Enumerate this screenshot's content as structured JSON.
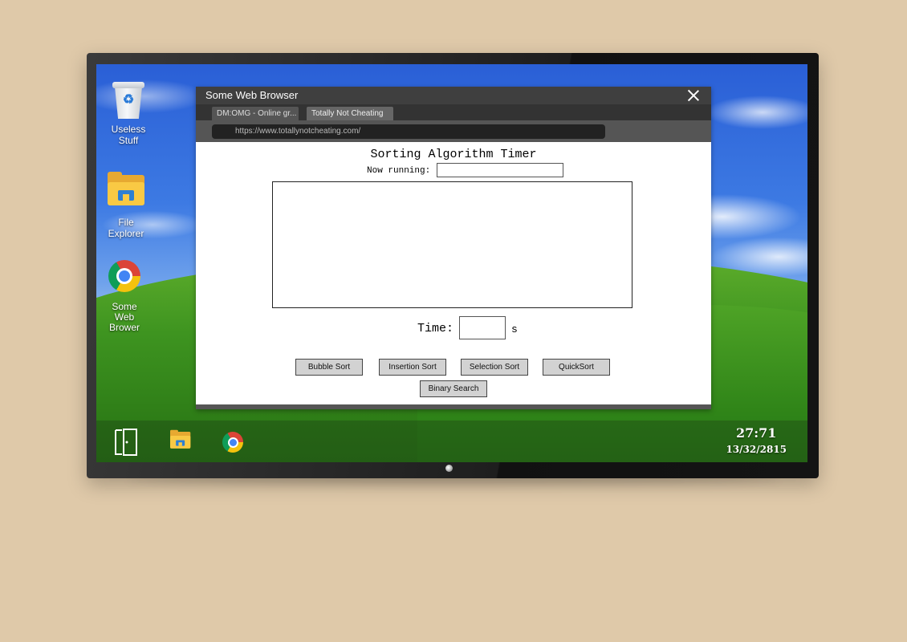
{
  "desktop": {
    "icons": [
      {
        "label": "Useless\nStuff",
        "icon": "recycle-bin-icon"
      },
      {
        "label": "File\nExplorer",
        "icon": "folder-icon"
      },
      {
        "label": "Some\nWeb\nBrower",
        "icon": "chrome-icon"
      }
    ]
  },
  "taskbar": {
    "items": [
      "exit-door-icon",
      "folder-icon",
      "chrome-icon"
    ],
    "clock": {
      "time": "27:71",
      "date": "13/32/2815"
    }
  },
  "browser": {
    "title": "Some Web Browser",
    "tabs": [
      {
        "label": "DM:OMG - Online gr..."
      },
      {
        "label": "Totally Not Cheating"
      }
    ],
    "url": "https://www.totallynotcheating.com/"
  },
  "app": {
    "title": "Sorting Algorithm Timer",
    "now_running_label": "Now running:",
    "now_running_value": "",
    "time_label": "Time:",
    "time_value": "",
    "time_unit": "s",
    "buttons": {
      "bubble": "Bubble Sort",
      "insertion": "Insertion Sort",
      "selection": "Selection Sort",
      "quick": "QuickSort",
      "binary": "Binary Search"
    }
  },
  "colors": {
    "browser_titlebar": "#3f3f3f",
    "tab_bar": "#333333",
    "button_bg": "#d2d2d2"
  }
}
